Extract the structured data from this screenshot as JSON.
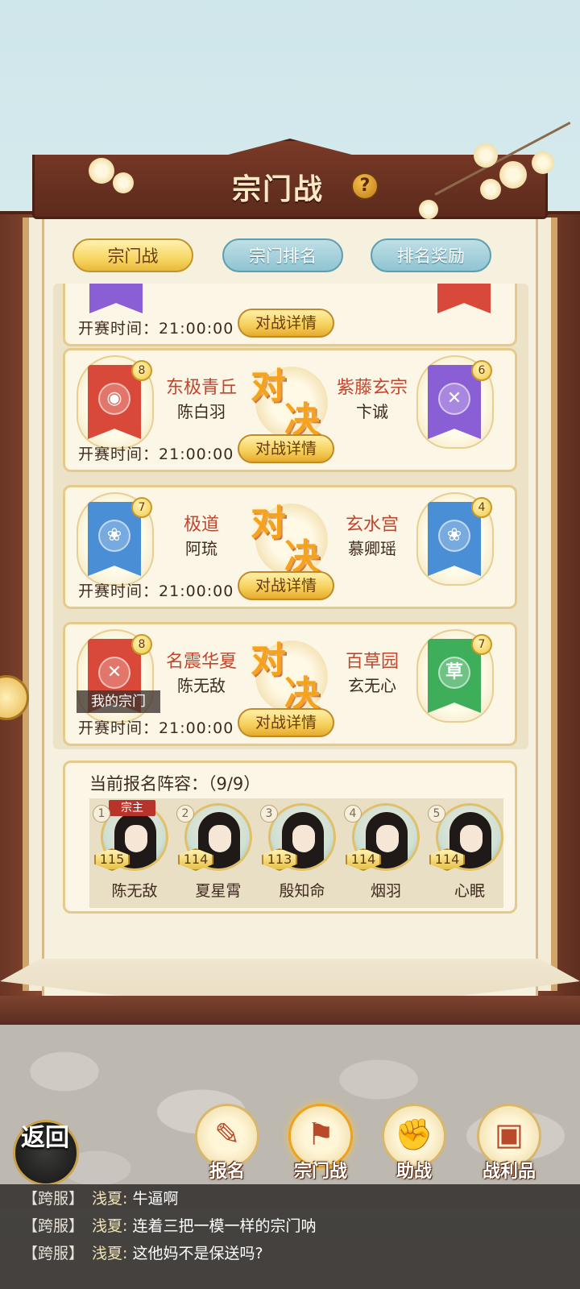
{
  "header": {
    "title": "宗门战"
  },
  "tabs": [
    {
      "label": "宗门战"
    },
    {
      "label": "宗门排名"
    },
    {
      "label": "排名奖励"
    }
  ],
  "matches": [
    {
      "time_label": "开赛时间：",
      "time": "21:00:00",
      "detail_label": "对战详情",
      "partial": true
    },
    {
      "left": {
        "sect": "东极青丘",
        "leader": "陈白羽",
        "rank": "8",
        "color": "#d8493a",
        "emblem": "coin"
      },
      "right": {
        "sect": "紫藤玄宗",
        "leader": "卞诚",
        "rank": "6",
        "color": "#8a5fd6",
        "emblem": "crossed-swords"
      },
      "vs_1": "对",
      "vs_2": "决",
      "time_label": "开赛时间：",
      "time": "21:00:00",
      "detail_label": "对战详情"
    },
    {
      "left": {
        "sect": "极道",
        "leader": "阿琉",
        "rank": "7",
        "color": "#4a8fd6",
        "emblem": "lotus"
      },
      "right": {
        "sect": "玄水宫",
        "leader": "慕卿瑶",
        "rank": "4",
        "color": "#4a8fd6",
        "emblem": "lotus"
      },
      "vs_1": "对",
      "vs_2": "决",
      "time_label": "开赛时间：",
      "time": "21:00:00",
      "detail_label": "对战详情"
    },
    {
      "left": {
        "sect": "名震华夏",
        "leader": "陈无敌",
        "rank": "8",
        "color": "#d8493a",
        "emblem": "crossed-swords",
        "tag": "我的宗门"
      },
      "right": {
        "sect": "百草园",
        "leader": "玄无心",
        "rank": "7",
        "color": "#3fae5a",
        "emblem_text": "草"
      },
      "vs_1": "对",
      "vs_2": "决",
      "time_label": "开赛时间：",
      "time": "21:00:00",
      "detail_label": "对战详情"
    }
  ],
  "roster": {
    "title": "当前报名阵容：（9/9）",
    "members": [
      {
        "slot": "1",
        "level": "115",
        "name": "陈无敌",
        "role": "宗主"
      },
      {
        "slot": "2",
        "level": "114",
        "name": "夏星霄"
      },
      {
        "slot": "3",
        "level": "113",
        "name": "殷知命"
      },
      {
        "slot": "4",
        "level": "114",
        "name": "烟羽"
      },
      {
        "slot": "5",
        "level": "114",
        "name": "心眠"
      }
    ]
  },
  "back_button": {
    "label": "返回"
  },
  "bottom_nav": [
    {
      "label": "报名",
      "icon": "scroll-brush-icon"
    },
    {
      "label": "宗门战",
      "icon": "flag-mountain-icon",
      "active": true
    },
    {
      "label": "助战",
      "icon": "handshake-icon"
    },
    {
      "label": "战利品",
      "icon": "treasure-chest-icon"
    }
  ],
  "chat": [
    {
      "channel": "【跨服】",
      "user": "浅夏:",
      "message": "牛逼啊"
    },
    {
      "channel": "【跨服】",
      "user": "浅夏:",
      "message": "连着三把一模一样的宗门呐"
    },
    {
      "channel": "【跨服】",
      "user": "浅夏:",
      "message": "这他妈不是保送吗?"
    }
  ]
}
